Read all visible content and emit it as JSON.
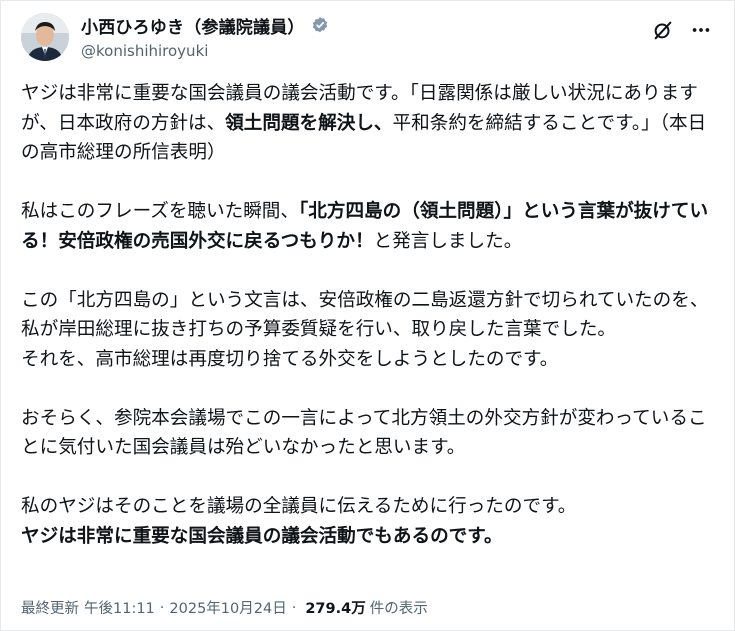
{
  "author": {
    "display_name": "小西ひろゆき（参議院議員）",
    "handle": "@konishihiroyuki",
    "verified_color": "#829aab"
  },
  "post": {
    "paragraphs": [
      [
        {
          "t": "ヤジは非常に重要な国会議員の議会活動です。「日露関係は厳しい状況にありますが、日本政府の方針は、",
          "b": false
        },
        {
          "t": "領土問題を解決し、",
          "b": true
        },
        {
          "t": "平和条約を締結することです。」（本日の高市総理の所信表明）",
          "b": false
        }
      ],
      [
        {
          "t": "私はこのフレーズを聴いた瞬間、",
          "b": false
        },
        {
          "t": "「北方四島の（領土問題）」という言葉が抜けている！安倍政権の売国外交に戻るつもりか！",
          "b": true
        },
        {
          "t": "と発言しました。",
          "b": false
        }
      ],
      [
        {
          "t": "この「北方四島の」という文言は、安倍政権の二島返還方針で切られていたのを、私が岸田総理に抜き打ちの予算委質疑を行い、取り戻した言葉でした。\nそれを、高市総理は再度切り捨てる外交をしようとしたのです。",
          "b": false
        }
      ],
      [
        {
          "t": "おそらく、参院本会議場でこの一言によって北方領土の外交方針が変わっていることに気付いた国会議員は殆どいなかったと思います。",
          "b": false
        }
      ],
      [
        {
          "t": "私のヤジはそのことを議場の全議員に伝えるために行ったのです。\n",
          "b": false
        },
        {
          "t": "ヤジは非常に重要な国会議員の議会活動でもあるのです。",
          "b": true
        }
      ]
    ],
    "meta": {
      "last_updated_label": "最終更新",
      "time": "午後11:11",
      "separator": "·",
      "date": "2025年10月24日",
      "views_count": "279.4万",
      "views_label": "件の表示"
    }
  }
}
